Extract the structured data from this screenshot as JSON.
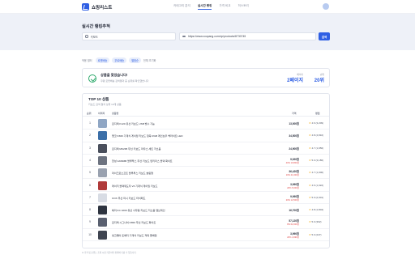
{
  "nav": {
    "logo": "쇼핑리스트",
    "links": [
      "카테고리 분석",
      "실시간 랭킹",
      "가격 비교",
      "히스토리"
    ],
    "active_index": 1
  },
  "hero": {
    "title": "실시간 랭킹추적",
    "keyword_value": "키보드",
    "url_value": "https://www.coupang.com/vp/products/8730745",
    "run_label": "검색"
  },
  "filters": {
    "label": "적용 필터",
    "chips": [
      "로켓배송",
      "무료배송",
      "별점순"
    ],
    "extra": "전체 초기화"
  },
  "result": {
    "title": "상품을 찾았습니다!",
    "subtitle": "쿠팡 로켓배송 검색결과 중 순위를 확인했습니다",
    "stats": [
      {
        "label": "페이지",
        "value": "2페이지"
      },
      {
        "label": "순위",
        "value": "20위"
      }
    ]
  },
  "table": {
    "title": "TOP 10 상품",
    "subtitle": "키보드 검색 결과 상위 10개 상품",
    "headers": {
      "rank": "순위",
      "image": "이미지",
      "name": "상품명",
      "price": "가격",
      "rating": "평점"
    },
    "rows": [
      {
        "rank": "1",
        "thumb_color": "#8fa6c4",
        "name": "로지텍 K120 유선 키보드 USB 방수 기능",
        "price": "13,000원",
        "discount": "",
        "rating": "4.6 (3,209)"
      },
      {
        "rank": "2",
        "thumb_color": "#3b6fa8",
        "name": "앱코 K660 기계식 게이밍 키보드 청축 RGB 레인보우 백라이트 LED",
        "price": "34,500원",
        "discount": "",
        "rating": "4.8 (4,810)"
      },
      {
        "rank": "3",
        "thumb_color": "#4a4f5c",
        "name": "로지텍 MK295 무선 키보드 마우스 세트 저소음",
        "price": "24,900원",
        "discount": "",
        "rating": "4.7 (1,956)"
      },
      {
        "rank": "4",
        "thumb_color": "#6d7380",
        "name": "한성 GK893B 블루투스 무선 키보드 텐키리스 블랙 화이트",
        "price": "9,920원",
        "discount": "40% 19,800원",
        "rating": "5.0 (3,186)"
      },
      {
        "rank": "5",
        "thumb_color": "#9aa2b0",
        "name": "마이크로소프트 블루투스 키보드 슬림형",
        "price": "36,420원",
        "discount": "10% 41,000원",
        "rating": "4.7 (1,000)"
      },
      {
        "rank": "6",
        "thumb_color": "#b03a3a",
        "name": "레이저 블랙위도우 V3 기계식 게이밍 키보드",
        "price": "3,990원",
        "discount": "20% 5,000원",
        "rating": "4.6 (1,022)"
      },
      {
        "rank": "7",
        "thumb_color": "#d8dce4",
        "name": "COX 무선 미니 키보드 터치패드",
        "price": "9,990원",
        "discount": "20% 12,500원",
        "rating": "5.0 (2,001)"
      },
      {
        "rank": "8",
        "thumb_color": "#2e3440",
        "name": "체리 KC 1000 유선 사무용 키보드 저소음 멤브레인",
        "price": "16,700원",
        "discount": "",
        "rating": "4.8 (1,804)"
      },
      {
        "rank": "9",
        "thumb_color": "#5a6070",
        "name": "로지텍 시그니처 K650 무선 키보드 화이트",
        "price": "57,120원",
        "discount": "8% 62,000원",
        "rating": "5.0 (362)"
      },
      {
        "rank": "10",
        "thumb_color": "#3f4450",
        "name": "씽크웨이 토체티 기계식 키보드 적축 풀배열",
        "price": "3,990원",
        "discount": "20% 4,990원",
        "rating": "5.0 (247)"
      }
    ]
  },
  "footnote": "※ 가격 및 순위는 조회 시점 기준이며 실제와 다를 수 있습니다."
}
